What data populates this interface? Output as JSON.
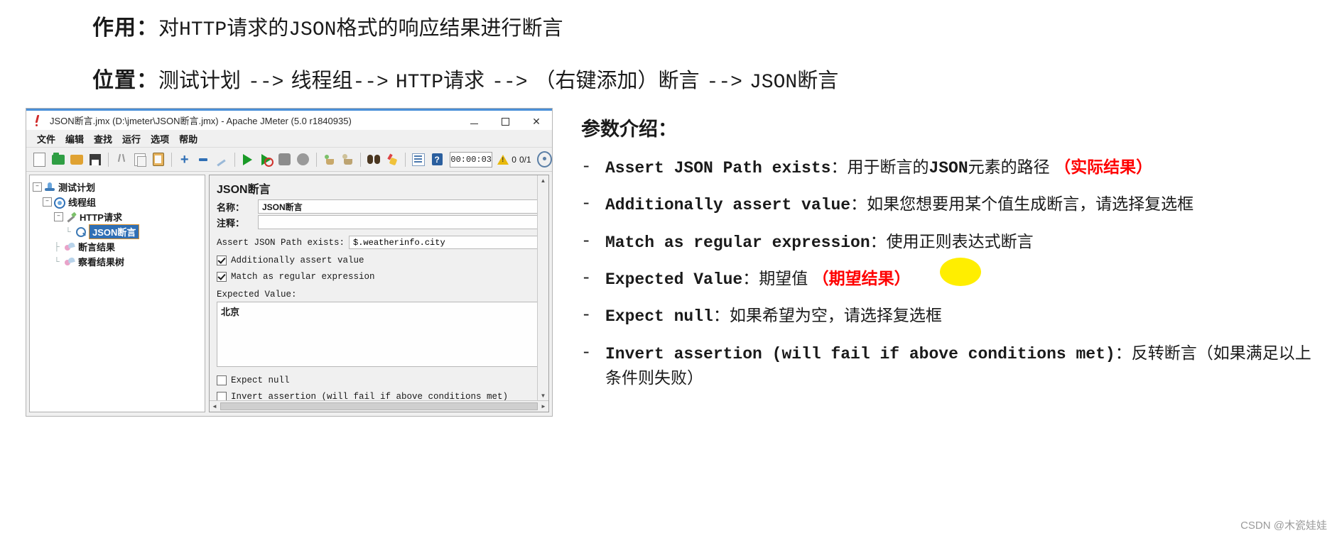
{
  "heading": {
    "line1": {
      "label": "作用：",
      "seg1_cjk": "对",
      "seg2_mono": "HTTP",
      "seg3_cjk": "请求的",
      "seg4_mono": "JSON",
      "seg5_cjk": "格式的响应结果进行断言"
    },
    "line2": {
      "label": "位置：",
      "seg1_cjk": "测试计划",
      "seg2_mono": "-->",
      "seg3_cjk": "线程组",
      "seg4_mono": "-->",
      "seg5_mono2": "HTTP",
      "seg6_cjk": "请求",
      "seg7_mono": "-->",
      "seg8_cjk": "（右键添加）断言",
      "seg9_mono": "-->",
      "seg10_mono2": "JSON",
      "seg11_cjk": "断言"
    }
  },
  "jmeter": {
    "title": "JSON断言.jmx (D:\\jmeter\\JSON断言.jmx) - Apache JMeter (5.0 r1840935)",
    "window_buttons": {
      "minimize": "–",
      "maximize": "□",
      "close": "✕"
    },
    "menu": [
      "文件",
      "编辑",
      "查找",
      "运行",
      "选项",
      "帮助"
    ],
    "toolbar": {
      "icons": [
        "new-file-icon",
        "open-template-icon",
        "open-folder-icon",
        "save-icon",
        "cut-icon",
        "copy-icon",
        "paste-icon",
        "expand-all-icon",
        "collapse-all-icon",
        "toggle-icon",
        "start-icon",
        "start-no-pauses-icon",
        "stop-icon",
        "shutdown-icon",
        "clear-icon",
        "clear-all-icon",
        "search-icon",
        "search-reset-icon",
        "function-helper-icon",
        "help-icon"
      ],
      "timer": "00:00:03",
      "warning_count": "0",
      "thread_count": "0/1",
      "gauge": "remote-gauge-icon"
    },
    "tree": [
      {
        "label": "测试计划",
        "icon": "test-plan-icon",
        "level": 0,
        "expander": "–",
        "selected": false
      },
      {
        "label": "线程组",
        "icon": "thread-group-icon",
        "level": 1,
        "expander": "–",
        "selected": false
      },
      {
        "label": "HTTP请求",
        "icon": "http-request-icon",
        "level": 2,
        "expander": "–",
        "selected": false
      },
      {
        "label": "JSON断言",
        "icon": "json-assertion-icon",
        "level": 3,
        "expander": "",
        "selected": true
      },
      {
        "label": "断言结果",
        "icon": "assertion-results-icon",
        "level": 3,
        "expander": "",
        "selected": false
      },
      {
        "label": "察看结果树",
        "icon": "view-results-tree-icon",
        "level": 3,
        "expander": "",
        "selected": false
      }
    ],
    "panel": {
      "title": "JSON断言",
      "name_label": "名称：",
      "name_value": "JSON断言",
      "comment_label": "注释：",
      "comment_value": "",
      "assert_path_label": "Assert JSON Path exists:",
      "assert_path_value": "$.weatherinfo.city",
      "cb_additionally_label": "Additionally assert value",
      "cb_additionally_checked": true,
      "cb_regex_label": "Match as regular expression",
      "cb_regex_checked": true,
      "expected_label": "Expected Value:",
      "expected_value": "北京",
      "cb_expect_null_label": "Expect null",
      "cb_expect_null_checked": false,
      "cb_invert_label": "Invert assertion (will fail if above conditions met)",
      "cb_invert_checked": false,
      "scroll_up": "▲",
      "scroll_down": "▼",
      "scroll_left": "◄",
      "scroll_right": "►"
    }
  },
  "explain": {
    "title": "参数介绍：",
    "bullets": [
      {
        "dash": "-",
        "term": "Assert JSON Path exists",
        "colon": "：",
        "desc_pre": "用于断言的",
        "desc_mono": "JSON",
        "desc_post": "元素的路径 ",
        "red": "（实际结果）"
      },
      {
        "dash": "-",
        "term": "Additionally assert value",
        "colon": "：",
        "desc_pre": "如果您想要用某个值生成断言，请选择复选框",
        "desc_mono": "",
        "desc_post": "",
        "red": ""
      },
      {
        "dash": "-",
        "term": "Match as regular expression",
        "colon": "：",
        "desc_pre": "使用正则表达式断言",
        "desc_mono": "",
        "desc_post": "",
        "red": ""
      },
      {
        "dash": "-",
        "term": "Expected Value",
        "colon": "：",
        "desc_pre": "期望值 ",
        "desc_mono": "",
        "desc_post": "",
        "red": "（期望结果）"
      },
      {
        "dash": "-",
        "term": "Expect null",
        "colon": "：",
        "desc_pre": "如果希望为空，请选择复选框",
        "desc_mono": "",
        "desc_post": "",
        "red": ""
      },
      {
        "dash": "-",
        "term": "Invert assertion (will fail if above conditions met)",
        "colon": "：",
        "desc_pre": "反转断言（如果满足以上条件则失败）",
        "desc_mono": "",
        "desc_post": "",
        "red": ""
      }
    ]
  },
  "watermark": "CSDN @木瓷娃娃",
  "colors": {
    "accent_blue": "#2f6fb5",
    "red_highlight": "#ff0000",
    "yellow_blob": "#ffee00",
    "title_bar_blue": "#4a90d9"
  }
}
